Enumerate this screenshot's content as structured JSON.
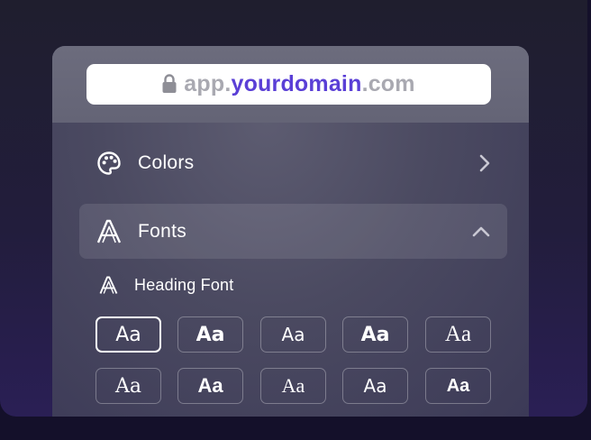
{
  "browser": {
    "url_prefix": "app.",
    "url_domain": "yourdomain",
    "url_suffix": ".com",
    "lock_icon": "lock-icon"
  },
  "menu": {
    "colors": {
      "label": "Colors",
      "icon": "palette-icon",
      "chevron": "chevron-right-icon"
    },
    "fonts": {
      "label": "Fonts",
      "icon": "font-icon",
      "chevron": "chevron-up-icon"
    }
  },
  "heading_font": {
    "label": "Heading Font",
    "icon": "font-icon"
  },
  "font_options": {
    "row1": [
      "Aa",
      "Aa",
      "Aa",
      "Aa",
      "Aa"
    ],
    "row2": [
      "Aa",
      "Aa",
      "Aa",
      "Aa",
      "Aa"
    ],
    "selected": "row1.0"
  },
  "colors": {
    "accent": "#5a3fd6",
    "url_muted": "#a9a9b1"
  }
}
